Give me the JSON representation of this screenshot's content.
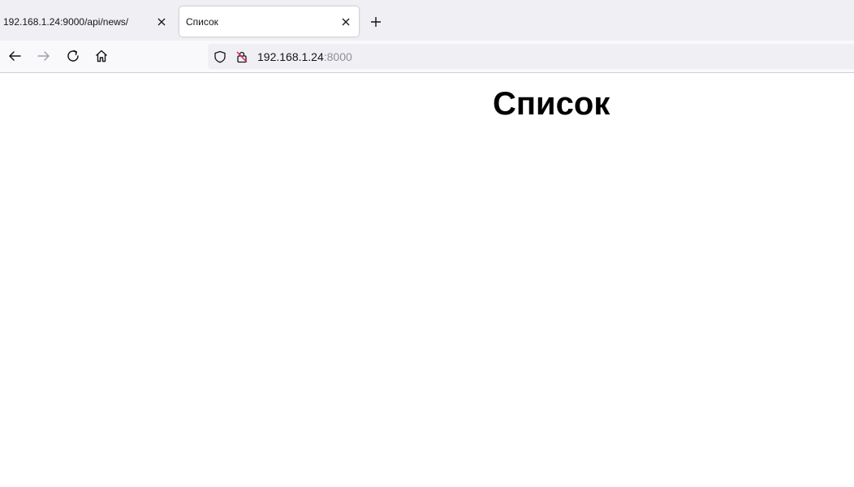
{
  "tabs": [
    {
      "title": "192.168.1.24:9000/api/news/",
      "active": false
    },
    {
      "title": "Список",
      "active": true
    }
  ],
  "toolbar": {
    "back_icon": "arrow-left-icon",
    "forward_icon": "arrow-right-icon",
    "reload_icon": "reload-icon",
    "home_icon": "home-icon"
  },
  "address_bar": {
    "host": "192.168.1.24",
    "port": ":8000"
  },
  "page": {
    "heading": "Список"
  },
  "colors": {
    "tabstrip_bg": "#f0f0f4",
    "navbar_bg": "#f9f9fb",
    "insecure_lock_red": "#e22850"
  }
}
